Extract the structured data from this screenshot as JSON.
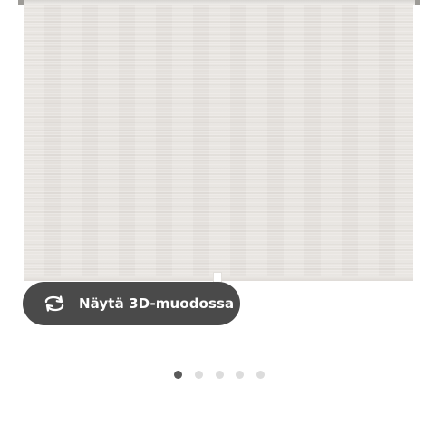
{
  "view_3d_button": {
    "label": "Näytä 3D-muodossa",
    "icon": "rotate-3d-icon"
  },
  "carousel": {
    "total_images": 5,
    "active_index": 0,
    "active_color": "#5a5a5a",
    "inactive_color": "#dcdcdc"
  },
  "colors": {
    "button_background": "#4a4a4a",
    "button_text": "#ffffff",
    "fabric": "#e8e4e0"
  }
}
